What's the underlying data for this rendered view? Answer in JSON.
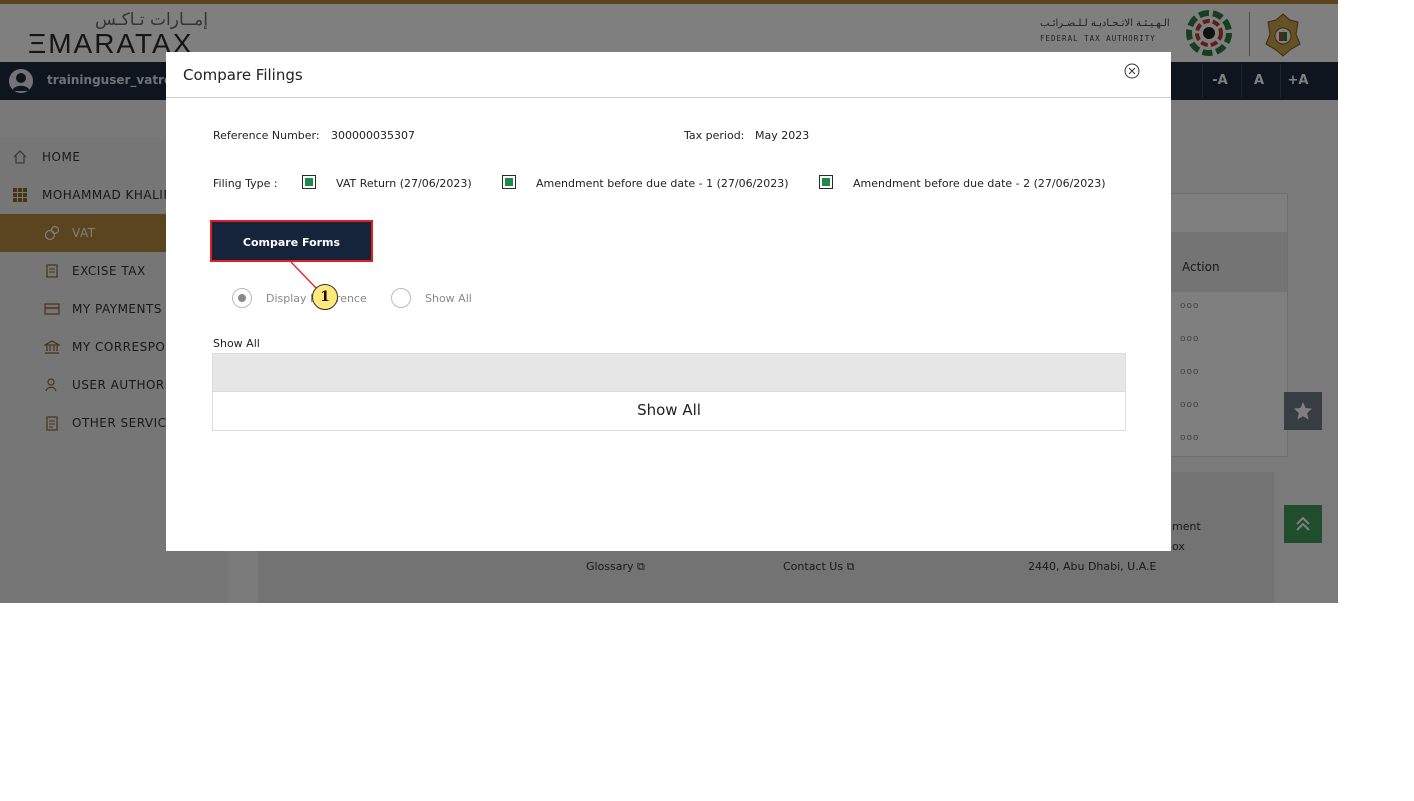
{
  "header": {
    "logo_ar": "إمــارات تـاكـس",
    "logo_en": "ΞMARATAX",
    "fta_ar": "الـهـيـئـة الاتـحـاديـة لـلـضـرائـب",
    "fta_en": "FEDERAL TAX AUTHORITY"
  },
  "userbar": {
    "username": "traininguser_vatretu",
    "font_buttons": [
      "-A",
      "A",
      "+A"
    ]
  },
  "sidebar": {
    "items": [
      {
        "label": "HOME",
        "icon": "home-icon"
      },
      {
        "label": "MOHAMMAD KHALIFA",
        "icon": "grid-icon"
      },
      {
        "label": "VAT",
        "icon": "coins-icon"
      },
      {
        "label": "EXCISE TAX",
        "icon": "document-icon"
      },
      {
        "label": "MY PAYMENTS",
        "icon": "card-icon"
      },
      {
        "label": "MY CORRESPON",
        "icon": "bank-icon"
      },
      {
        "label": "USER AUTHORIZ",
        "icon": "user-icon"
      },
      {
        "label": "OTHER SERVICE",
        "icon": "clipboard-icon"
      }
    ]
  },
  "background": {
    "action_header": "Action",
    "row_menu": "ooo",
    "footer": {
      "glossary": "Glossary",
      "contact_us": "Contact Us",
      "address_part": "ment",
      "address_box": "ox",
      "address": "2440, Abu Dhabi, U.A.E"
    }
  },
  "modal": {
    "title": "Compare Filings",
    "reference_label": "Reference Number:",
    "reference_value": "300000035307",
    "tax_period_label": "Tax period:",
    "tax_period_value": "May 2023",
    "filing_type_label": "Filing Type :",
    "filing_options": [
      {
        "label": "VAT Return (27/06/2023)",
        "checked": true
      },
      {
        "label": "Amendment before due date - 1 (27/06/2023)",
        "checked": true
      },
      {
        "label": "Amendment before due date - 2 (27/06/2023)",
        "checked": true
      }
    ],
    "compare_button": "Compare Forms",
    "radio_options": [
      {
        "label": "Display Difference",
        "selected": true
      },
      {
        "label": "Show All",
        "selected": false
      }
    ],
    "section_label": "Show All",
    "table_row_text": "Show All"
  },
  "annotation": {
    "step": "1"
  },
  "colors": {
    "brand_gold": "#b48a3e",
    "navy": "#15243a",
    "highlight_red": "#e02020",
    "check_green": "#1c8a4a"
  }
}
